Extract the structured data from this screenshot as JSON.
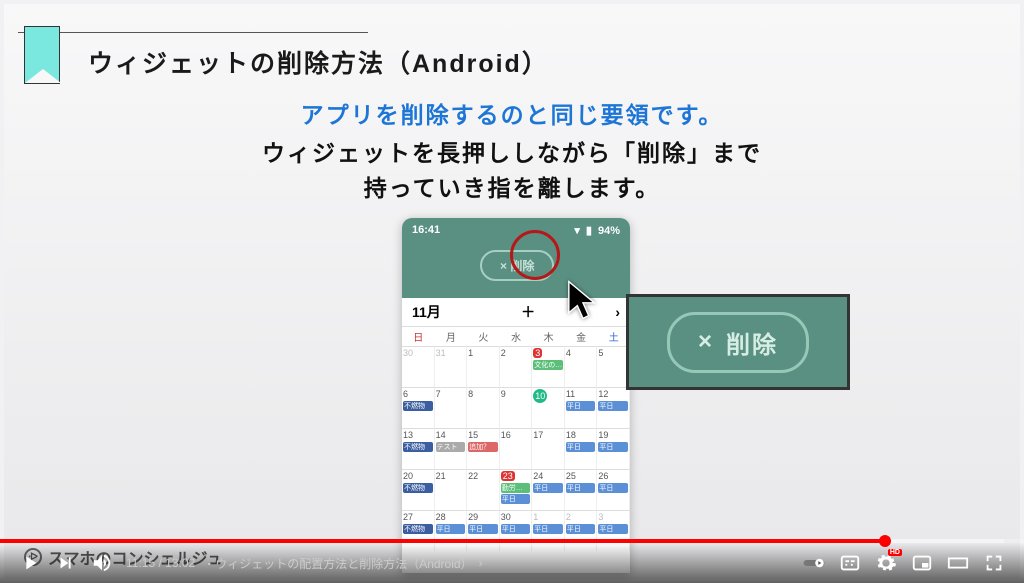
{
  "slide": {
    "title": "ウィジェットの削除方法（Android）",
    "subtitle_blue": "アプリを削除するのと同じ要領です。",
    "subtitle_black_line1": "ウィジェットを長押ししながら「削除」まで",
    "subtitle_black_line2": "持っていき指を離します。",
    "watermark": "スマホのコンシェルジュ"
  },
  "phone": {
    "time": "16:41",
    "battery": "94%",
    "delete_pill": "× 削除",
    "month_label": "11月",
    "plus": "＋",
    "dow": [
      "日",
      "月",
      "火",
      "水",
      "木",
      "金",
      "土"
    ],
    "rows": [
      [
        {
          "n": "30",
          "dim": true
        },
        {
          "n": "31",
          "dim": true
        },
        {
          "n": "1"
        },
        {
          "n": "2"
        },
        {
          "n": "3",
          "holiday": true,
          "ev": [
            {
              "t": "文化の…",
              "c": "green"
            }
          ]
        },
        {
          "n": "4"
        },
        {
          "n": "5"
        }
      ],
      [
        {
          "n": "6",
          "ev": [
            {
              "t": "不燃物",
              "c": "navy"
            }
          ]
        },
        {
          "n": "7"
        },
        {
          "n": "8"
        },
        {
          "n": "9"
        },
        {
          "n": "10",
          "today": true
        },
        {
          "n": "11",
          "ev": [
            {
              "t": "平日",
              "c": "blue"
            }
          ]
        },
        {
          "n": "12",
          "ev": [
            {
              "t": "平日",
              "c": "blue"
            }
          ]
        }
      ],
      [
        {
          "n": "13",
          "ev": [
            {
              "t": "不燃物",
              "c": "navy"
            }
          ]
        },
        {
          "n": "14",
          "ev": [
            {
              "t": "テスト",
              "c": "gray"
            }
          ]
        },
        {
          "n": "15",
          "ev": [
            {
              "t": "追加？",
              "c": "red"
            }
          ]
        },
        {
          "n": "16"
        },
        {
          "n": "17"
        },
        {
          "n": "18",
          "ev": [
            {
              "t": "平日",
              "c": "blue"
            }
          ]
        },
        {
          "n": "19",
          "ev": [
            {
              "t": "平日",
              "c": "blue"
            }
          ]
        }
      ],
      [
        {
          "n": "20",
          "ev": [
            {
              "t": "不燃物",
              "c": "navy"
            }
          ]
        },
        {
          "n": "21"
        },
        {
          "n": "22"
        },
        {
          "n": "23",
          "holiday": true,
          "ev": [
            {
              "t": "勤労…",
              "c": "green"
            },
            {
              "t": "平日",
              "c": "blue"
            }
          ]
        },
        {
          "n": "24",
          "ev": [
            {
              "t": "平日",
              "c": "blue"
            }
          ]
        },
        {
          "n": "25",
          "ev": [
            {
              "t": "平日",
              "c": "blue"
            }
          ]
        },
        {
          "n": "26",
          "ev": [
            {
              "t": "平日",
              "c": "blue"
            }
          ]
        }
      ],
      [
        {
          "n": "27",
          "ev": [
            {
              "t": "不燃物",
              "c": "navy"
            }
          ]
        },
        {
          "n": "28",
          "ev": [
            {
              "t": "平日",
              "c": "blue"
            }
          ]
        },
        {
          "n": "29",
          "ev": [
            {
              "t": "平日",
              "c": "blue"
            }
          ]
        },
        {
          "n": "30",
          "ev": [
            {
              "t": "平日",
              "c": "blue"
            }
          ]
        },
        {
          "n": "1",
          "dim": true,
          "ev": [
            {
              "t": "平日",
              "c": "blue"
            }
          ]
        },
        {
          "n": "2",
          "dim": true,
          "ev": [
            {
              "t": "平日",
              "c": "blue"
            }
          ]
        },
        {
          "n": "3",
          "dim": true,
          "ev": [
            {
              "t": "平日",
              "c": "blue"
            }
          ]
        }
      ]
    ]
  },
  "callout": {
    "x": "×",
    "text": "削除"
  },
  "player": {
    "current": "11:15",
    "total": "13:02",
    "chapter": "・ウィジェットの配置方法と削除方法（Android）",
    "hd": "HD",
    "progress_pct": 86.4,
    "buffer_pct": 98.0
  }
}
